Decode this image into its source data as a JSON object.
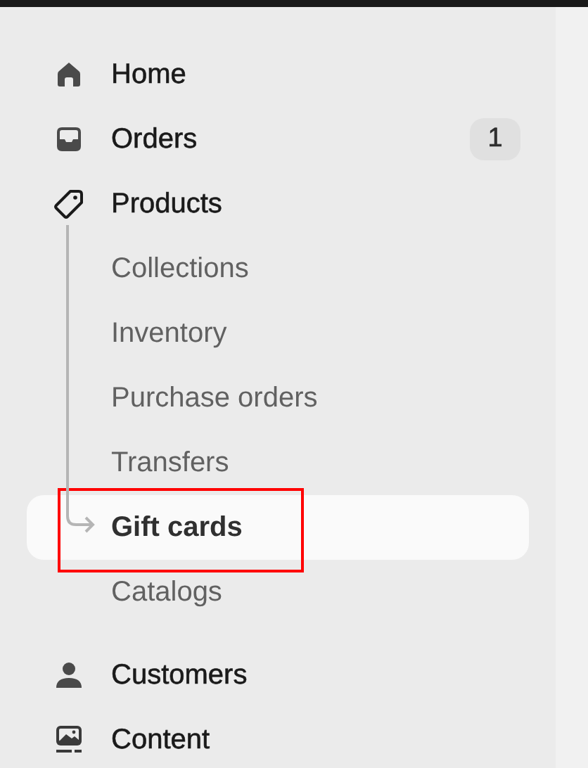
{
  "sidebar": {
    "items": [
      {
        "label": "Home",
        "selected": false
      },
      {
        "label": "Orders",
        "selected": false,
        "badge": "1"
      },
      {
        "label": "Products",
        "selected": false,
        "children": [
          {
            "label": "Collections",
            "selected": false
          },
          {
            "label": "Inventory",
            "selected": false
          },
          {
            "label": "Purchase orders",
            "selected": false
          },
          {
            "label": "Transfers",
            "selected": false
          },
          {
            "label": "Gift cards",
            "selected": true
          },
          {
            "label": "Catalogs",
            "selected": false
          }
        ]
      },
      {
        "label": "Customers",
        "selected": false
      },
      {
        "label": "Content",
        "selected": false
      }
    ]
  }
}
